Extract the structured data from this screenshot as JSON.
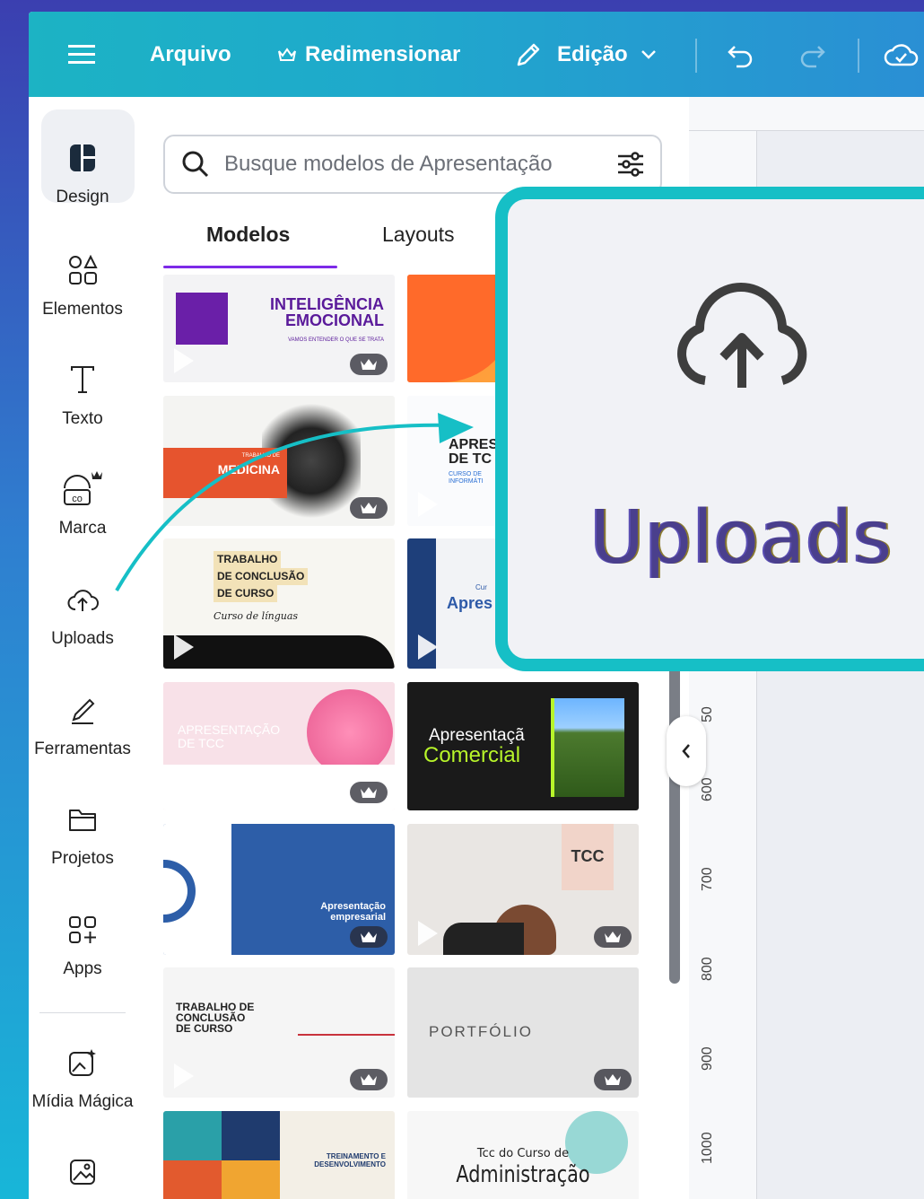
{
  "topbar": {
    "menu_label": "",
    "file": "Arquivo",
    "resize": "Redimensionar",
    "edit": "Edição"
  },
  "rail": {
    "items": [
      {
        "label": "Design"
      },
      {
        "label": "Elementos"
      },
      {
        "label": "Texto"
      },
      {
        "label": "Marca"
      },
      {
        "label": "Uploads"
      },
      {
        "label": "Ferramentas"
      },
      {
        "label": "Projetos"
      },
      {
        "label": "Apps"
      },
      {
        "label": "Mídia Mágica"
      }
    ]
  },
  "panel": {
    "search_placeholder": "Busque modelos de Apresentação",
    "tabs": [
      {
        "label": "Modelos"
      },
      {
        "label": "Layouts"
      }
    ]
  },
  "templates": {
    "t1": {
      "line1": "INTELIGÊNCIA",
      "line2": "EMOCIONAL",
      "sub": "VAMOS ENTENDER O QUE SE TRATA"
    },
    "t3": {
      "title": "MEDICINA",
      "kicker": "TRABALHO DE"
    },
    "t4": {
      "title": "APRES",
      "sub1": "DE TC",
      "sub2": "CURSO DE",
      "sub3": "INFORMÁTI"
    },
    "t5": {
      "l1": "TRABALHO",
      "l2": "DE CONCLUSÃO",
      "l3": "DE CURSO",
      "script": "Curso de línguas"
    },
    "t6": {
      "title": "Apres",
      "kicker": "Cur"
    },
    "t7": {
      "l1": "APRESENTAÇÃO",
      "l2": "DE TCC"
    },
    "t8": {
      "l1": "Apresentaçã",
      "l2": "Comercial"
    },
    "t9": {
      "l1": "Apresentação",
      "l2": "empresarial"
    },
    "t10": {
      "title": "TCC"
    },
    "t11": {
      "l1": "TRABALHO DE",
      "l2": "CONCLUSÃO",
      "l3": "DE CURSO"
    },
    "t12": {
      "title": "PORTFÓLIO"
    },
    "t13": {
      "l1": "TREINAMENTO E",
      "l2": "DESENVOLVIMENTO"
    },
    "t14": {
      "l1": "Tcc do Curso de",
      "l2": "Administração"
    }
  },
  "ruler": {
    "labels": [
      "50",
      "600",
      "700",
      "800",
      "900",
      "1000"
    ]
  },
  "zoom": {
    "label": "Uploads"
  },
  "colors": {
    "accent": "#16bfc6",
    "tab_underline": "#7d2ae8",
    "zoom_text": "#4a3f8d"
  }
}
